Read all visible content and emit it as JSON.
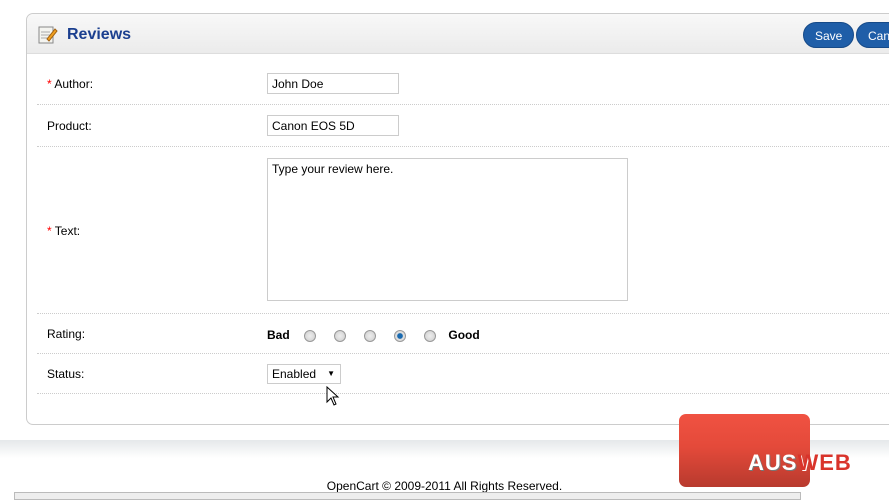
{
  "header": {
    "title": "Reviews",
    "icon": "notepad-pencil-icon",
    "save_label": "Save",
    "cancel_label": "Cancel"
  },
  "form": {
    "author": {
      "label": "Author:",
      "required": true,
      "value": "John Doe"
    },
    "product": {
      "label": "Product:",
      "value": "Canon EOS 5D"
    },
    "text": {
      "label": "Text:",
      "required": true,
      "value": "Type your review here."
    },
    "rating": {
      "label": "Rating:",
      "low": "Bad",
      "high": "Good",
      "options": [
        1,
        2,
        3,
        4,
        5
      ],
      "selected": 4
    },
    "status": {
      "label": "Status:",
      "value": "Enabled"
    }
  },
  "footer": {
    "copyright": "OpenCart © 2009-2011 All Rights Reserved."
  },
  "watermark": {
    "text_white": "AUS",
    "text_red": "WEB"
  },
  "colors": {
    "accent": "#1f5ea8",
    "title": "#1b3f8f"
  }
}
